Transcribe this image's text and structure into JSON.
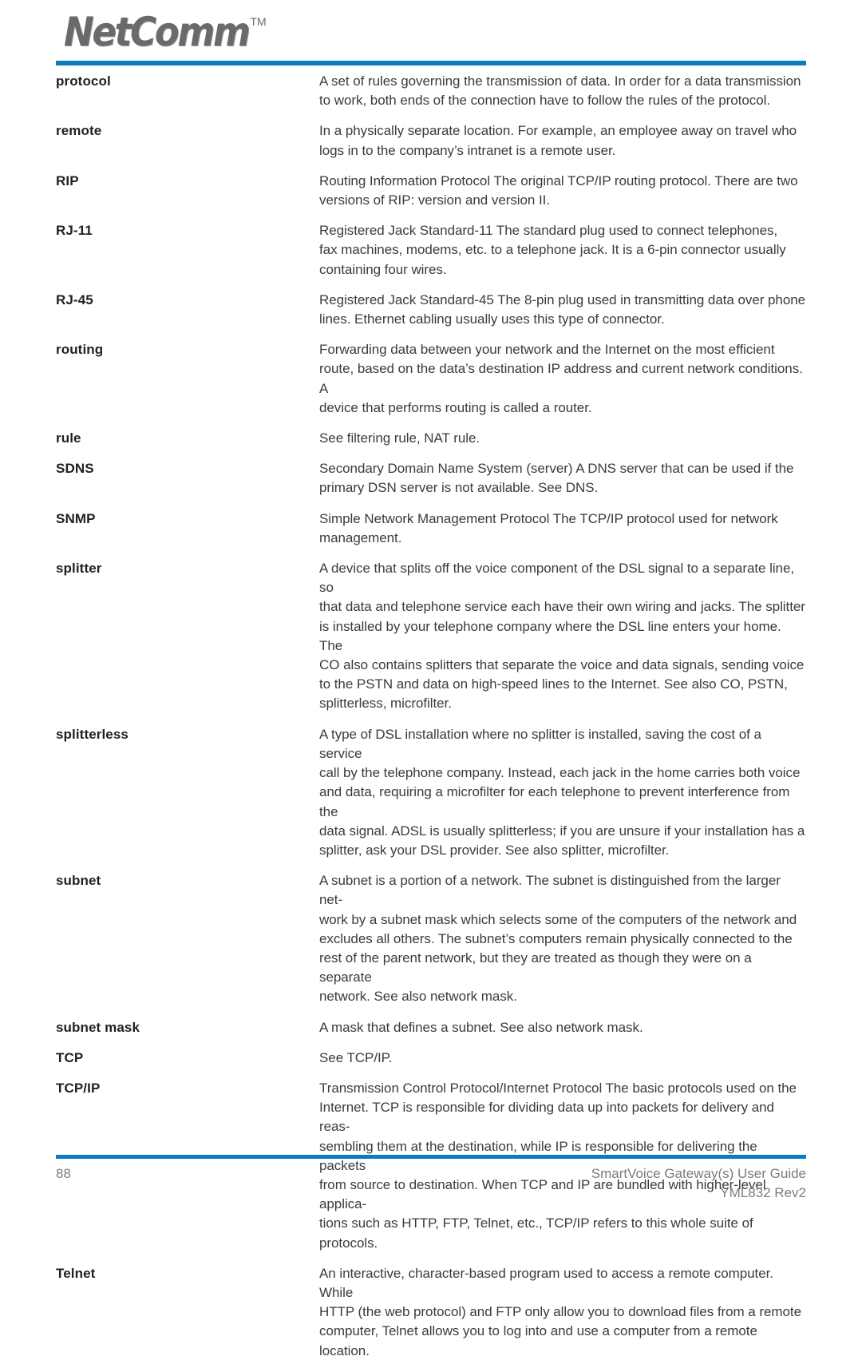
{
  "header": {
    "logo_text": "NetComm",
    "logo_trademark": "TM",
    "accent_color": "#0b7cc0"
  },
  "glossary": {
    "entries": [
      {
        "term": "protocol",
        "definition": "A set of rules governing the transmission of data. In order for a data transmission\nto work, both ends of the connection have to follow the rules of the protocol."
      },
      {
        "term": "remote",
        "definition": "In a physically separate location. For example, an employee away on travel who\nlogs in to the company’s intranet is a remote user."
      },
      {
        "term": "RIP",
        "definition": "Routing Information Protocol The original TCP/IP routing protocol. There are two\nversions of RIP: version and version II."
      },
      {
        "term": "RJ-11",
        "definition": "Registered Jack Standard-11 The standard plug used to connect telephones,\nfax machines, modems, etc. to a telephone jack. It is a 6-pin connector usually\ncontaining four wires."
      },
      {
        "term": "RJ-45",
        "definition": "Registered Jack Standard-45 The 8-pin plug used in transmitting data over phone\nlines. Ethernet cabling usually uses this type of connector."
      },
      {
        "term": "routing",
        "definition": "Forwarding data between your network and the Internet on the most efficient\nroute, based on the data’s destination IP address and current network conditions. A\ndevice that performs routing is called a router."
      },
      {
        "term": "rule",
        "definition": "See filtering rule, NAT rule."
      },
      {
        "term": "SDNS",
        "definition": "Secondary Domain Name System (server) A DNS server that can be used if the\nprimary DSN server is not available. See DNS."
      },
      {
        "term": "SNMP",
        "definition": "Simple Network Management Protocol The TCP/IP protocol used for network\nmanagement."
      },
      {
        "term": "splitter",
        "definition": "A device that splits off the voice component of the DSL signal to a separate line, so\nthat data and telephone service each have their own wiring and jacks. The splitter\nis installed by your telephone company where the DSL line enters your home. The\nCO also contains splitters that separate the voice and data signals, sending voice\nto the PSTN and data on high-speed lines to the  Internet. See also CO, PSTN,\nsplitterless, microfilter."
      },
      {
        "term": "splitterless",
        "definition": "A type of DSL installation where no splitter is installed, saving the cost of a service\ncall by the telephone company. Instead, each jack in the home carries both voice\nand data, requiring a microfilter for each telephone to prevent interference from the\ndata signal. ADSL is usually splitterless; if you are unsure if your installation has a\nsplitter, ask your DSL provider. See also splitter, microfilter."
      },
      {
        "term": "subnet",
        "definition": "A subnet is a portion of a network. The subnet is distinguished from the larger net-\nwork by a subnet mask which selects some of the computers of the network and\nexcludes all others. The subnet’s computers remain physically connected to the\nrest of the parent network, but they are treated as though they were on a separate\nnetwork. See also network mask."
      },
      {
        "term": "subnet mask",
        "definition": "A mask that defines a subnet. See also network mask."
      },
      {
        "term": "TCP",
        "definition": "See TCP/IP."
      },
      {
        "term": "TCP/IP",
        "definition": "Transmission Control Protocol/Internet Protocol The basic protocols used on the\nInternet. TCP is responsible for dividing data up into packets for delivery and reas-\nsembling them at the destination, while IP is responsible for delivering the packets\nfrom source to destination. When TCP and IP are bundled with higher-level applica-\ntions such as HTTP, FTP, Telnet, etc., TCP/IP refers to this whole suite of protocols."
      },
      {
        "term": "Telnet",
        "definition": "An interactive, character-based program used to access a remote computer. While\nHTTP (the web protocol) and FTP only allow you to download files from a remote\ncomputer, Telnet allows you to log into and use a computer from a remote location."
      }
    ]
  },
  "footer": {
    "page_number": "88",
    "document_title": "SmartVoice Gateway(s) User Guide",
    "document_revision": "YML832 Rev2"
  }
}
